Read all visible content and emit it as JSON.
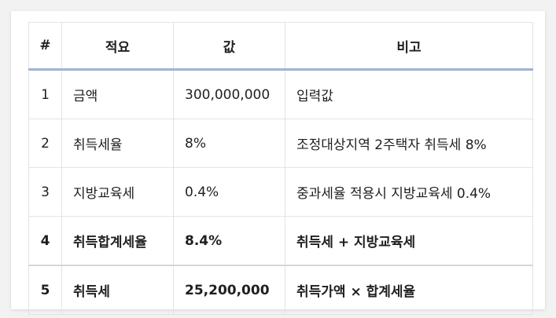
{
  "table": {
    "headers": [
      "#",
      "적요",
      "값",
      "비고"
    ],
    "rows": [
      {
        "num": "1",
        "item": "금액",
        "value": "300,000,000",
        "note": "입력값",
        "bold": false
      },
      {
        "num": "2",
        "item": "취득세율",
        "value": "8%",
        "note": "조정대상지역 2주택자 취득세 8%",
        "bold": false
      },
      {
        "num": "3",
        "item": "지방교육세",
        "value": "0.4%",
        "note": "중과세율 적용시 지방교육세 0.4%",
        "bold": false
      },
      {
        "num": "4",
        "item": "취득합계세율",
        "value": "8.4%",
        "note": "취득세 + 지방교육세",
        "bold": true
      },
      {
        "num": "5",
        "item": "취득세",
        "value": "25,200,000",
        "note": "취득가액 × 합계세율",
        "bold": true
      }
    ]
  },
  "colors": {
    "header_rule": "#9bb3d8",
    "grid": "#e3e3e3",
    "text": "#1f1f1f"
  }
}
